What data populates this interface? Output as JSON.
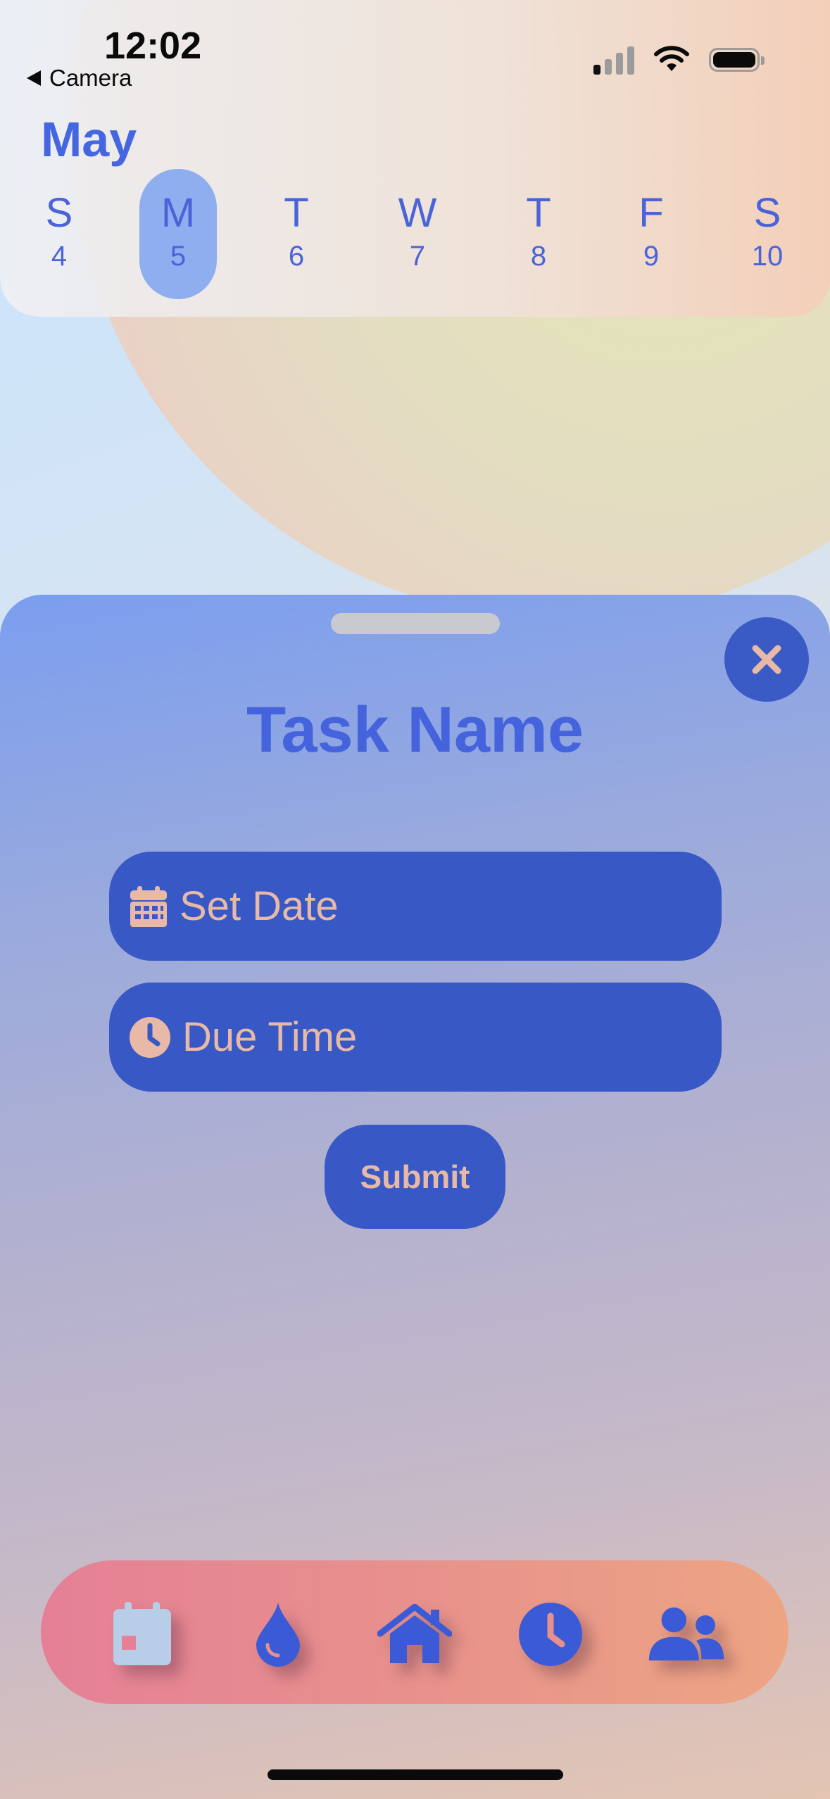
{
  "status_bar": {
    "time": "12:02",
    "back_label": "Camera"
  },
  "calendar": {
    "month": "May",
    "days": [
      {
        "letter": "S",
        "number": "4",
        "selected": false
      },
      {
        "letter": "M",
        "number": "5",
        "selected": true
      },
      {
        "letter": "T",
        "number": "6",
        "selected": false
      },
      {
        "letter": "W",
        "number": "7",
        "selected": false
      },
      {
        "letter": "T",
        "number": "8",
        "selected": false
      },
      {
        "letter": "F",
        "number": "9",
        "selected": false
      },
      {
        "letter": "S",
        "number": "10",
        "selected": false
      }
    ]
  },
  "sheet": {
    "title": "Task Name",
    "date_placeholder": "Set Date",
    "time_placeholder": "Due Time",
    "submit_label": "Submit"
  },
  "tabbar": {
    "items": [
      {
        "icon": "calendar-icon",
        "active": false
      },
      {
        "icon": "drop-icon",
        "active": true
      },
      {
        "icon": "home-icon",
        "active": true
      },
      {
        "icon": "clock-icon",
        "active": true
      },
      {
        "icon": "users-icon",
        "active": true
      }
    ]
  },
  "colors": {
    "accent": "#4466e0",
    "field_bg": "#3858c5",
    "field_text": "#e8b9a6",
    "selected_day_bg": "#8eaef0",
    "tabbar_start": "#e58096",
    "tabbar_end": "#eda583",
    "inactive_icon": "#b7cde8"
  }
}
